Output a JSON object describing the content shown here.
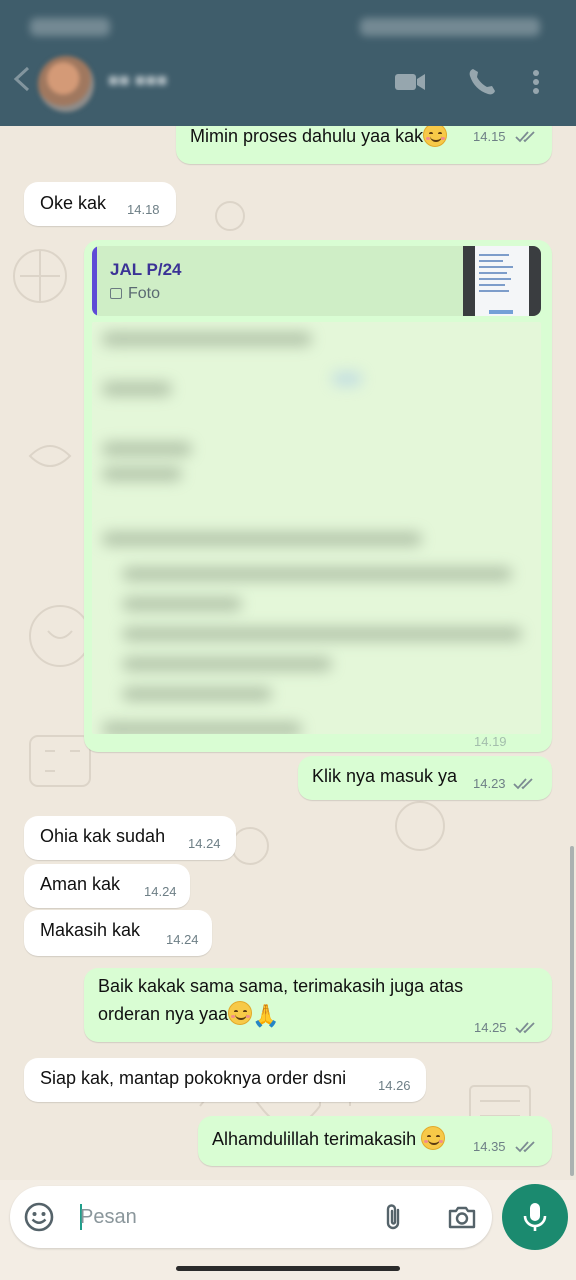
{
  "header": {
    "icons": [
      "video-call-icon",
      "voice-call-icon",
      "more-vert-icon"
    ],
    "colors": {
      "header_bg": "#3f5d6b"
    }
  },
  "messages": [
    {
      "direction": "out",
      "text": "Mimin proses dahulu yaa kak",
      "time": "14.15",
      "emoji": "smiling-face"
    },
    {
      "direction": "in",
      "text": "Oke kak",
      "time": "14.18"
    },
    {
      "direction": "out",
      "type": "image-reply",
      "reply_title": "JAL P/24",
      "reply_sub": "Foto",
      "time": "14.19"
    },
    {
      "direction": "out",
      "text": "Klik nya masuk ya",
      "time": "14.23"
    },
    {
      "direction": "in",
      "text": "Ohia kak sudah",
      "time": "14.24"
    },
    {
      "direction": "in",
      "text": "Aman kak",
      "time": "14.24"
    },
    {
      "direction": "in",
      "text": "Makasih kak",
      "time": "14.24"
    },
    {
      "direction": "out",
      "text_line1": "Baik kakak sama sama, terimakasih juga atas",
      "text_line2": "orderan nya yaa",
      "time": "14.25",
      "emoji": "smiling-face, folded-hands"
    },
    {
      "direction": "in",
      "text": "Siap kak, mantap pokoknya order dsni",
      "time": "14.26"
    },
    {
      "direction": "out",
      "text": "Alhamdulillah terimakasih",
      "time": "14.35",
      "emoji": "smiling-face"
    }
  ],
  "composer": {
    "placeholder": "Pesan",
    "icons": [
      "emoji-icon",
      "attach-icon",
      "camera-icon",
      "mic-icon"
    ]
  },
  "colors": {
    "outgoing_bubble": "#d9fdd3",
    "incoming_bubble": "#ffffff",
    "chat_bg": "#efe8dd",
    "mic_button": "#1b8a6f",
    "read_ticks": "#7c8b92"
  }
}
